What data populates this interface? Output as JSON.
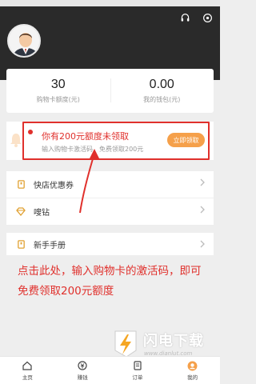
{
  "stats": [
    {
      "value": "30",
      "label": "购物卡额度(元)"
    },
    {
      "value": "0.00",
      "label": "我的钱包(元)"
    }
  ],
  "promo": {
    "title": "你有200元额度未领取",
    "subtitle": "输入购物卡激活码，免费领取200元",
    "button": "立即领取"
  },
  "menu": {
    "coupons": "快店优惠券",
    "diamond": "嗖钻",
    "guide": "新手手册"
  },
  "annotation": "点击此处，输入购物卡的激活码，即可免费领取200元额度",
  "watermark": {
    "name": "闪电下载",
    "url": "www.dianlut.com"
  },
  "tabs": [
    {
      "label": "主页",
      "icon": "home-icon"
    },
    {
      "label": "赚钱",
      "icon": "money-icon"
    },
    {
      "label": "订单",
      "icon": "order-icon"
    },
    {
      "label": "我的",
      "icon": "profile-icon"
    }
  ],
  "colors": {
    "accent_red": "#e0302c",
    "button_orange": "#f5a04a",
    "header_dark": "#2a2a2a"
  }
}
